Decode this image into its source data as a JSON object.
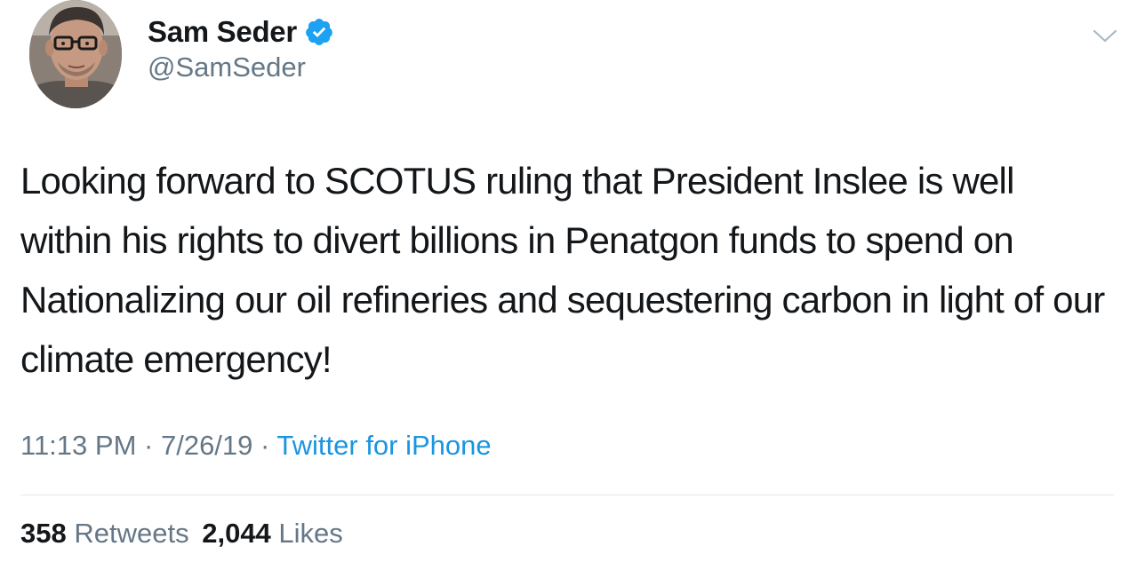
{
  "author": {
    "display_name": "Sam Seder",
    "handle": "@SamSeder",
    "verified": true,
    "avatar_icon": "profile-photo"
  },
  "tweet": {
    "text": "Looking forward to SCOTUS ruling that President Inslee is well within his rights to divert billions in Penatgon funds to spend on Nationalizing our oil refineries and sequestering carbon in light of our climate emergency!"
  },
  "meta": {
    "time": "11:13 PM",
    "date": "7/26/19",
    "separator": "·",
    "source": "Twitter for iPhone"
  },
  "stats": {
    "retweets_count": "358",
    "retweets_label": "Retweets",
    "likes_count": "2,044",
    "likes_label": "Likes"
  },
  "colors": {
    "text_primary": "#14171a",
    "text_secondary": "#657786",
    "link": "#1b95e0",
    "verified_badge": "#1da1f2",
    "divider": "#e1e8ed"
  }
}
